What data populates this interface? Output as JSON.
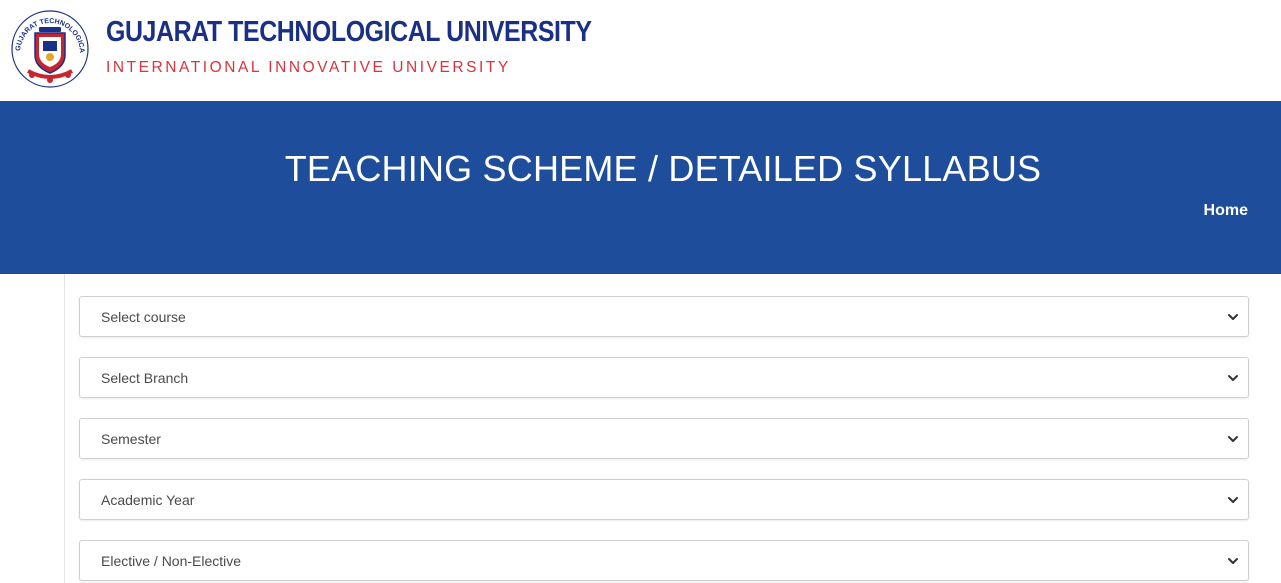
{
  "header": {
    "title": "GUJARAT TECHNOLOGICAL UNIVERSITY",
    "subtitle": "INTERNATIONAL INNOVATIVE UNIVERSITY",
    "logo_icon": "university-seal-icon",
    "logo_text": "GUJARAT TECHNOLOGICAL UNIVERSITY"
  },
  "banner": {
    "title": "TEACHING SCHEME / DETAILED SYLLABUS",
    "home_link": "Home",
    "background_color": "#1e4d9c"
  },
  "filters": [
    {
      "label": "Select course",
      "icon": "chevron-down-icon"
    },
    {
      "label": "Select Branch",
      "icon": "chevron-down-icon"
    },
    {
      "label": "Semester",
      "icon": "chevron-down-icon"
    },
    {
      "label": "Academic Year",
      "icon": "chevron-down-icon"
    },
    {
      "label": "Elective / Non-Elective",
      "icon": "chevron-down-icon"
    }
  ],
  "colors": {
    "brand_blue": "#1a2f86",
    "brand_red": "#d9343b",
    "banner_blue": "#1e4d9c"
  }
}
